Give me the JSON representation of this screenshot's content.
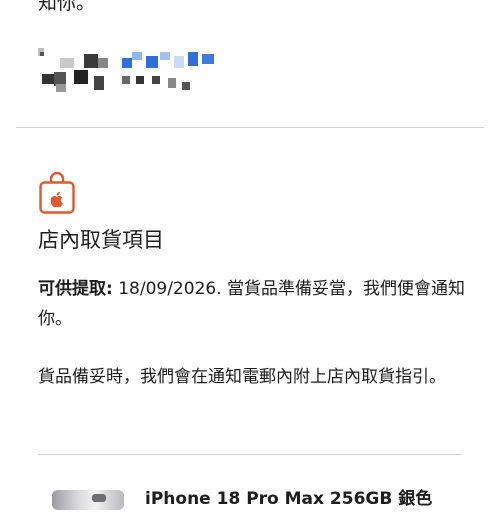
{
  "top_text": "知你。",
  "section": {
    "title": "店內取貨項目",
    "pickup_label": "可供提取:",
    "pickup_text": " 18/09/2026. 當貨品準備妥當，我們便會通知你。",
    "notice": "貨品備妥時，我們會在通知電郵內附上店內取貨指引。",
    "icon": "apple-bag-icon",
    "accent_color": "#e0592a"
  },
  "product": {
    "name": "iPhone 18 Pro Max 256GB 銀色"
  }
}
